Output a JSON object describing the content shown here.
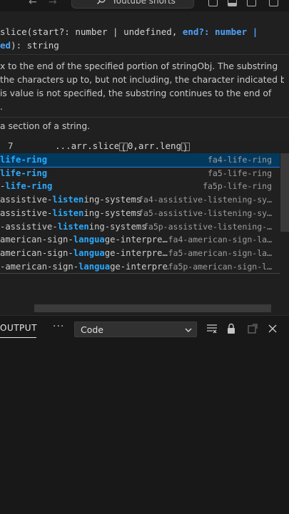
{
  "titlebar": {
    "search_text": "Youtube shorts",
    "back_arrow": "←",
    "forward_arrow": "→"
  },
  "hover_doc": {
    "signature_line1_prefix": "slice(start?: number | undefined, ",
    "signature_line1_param": "end?: number |",
    "signature_line2_param_tail": "ed",
    "signature_line2_rest": "): string",
    "description_lines": [
      "x to the end of the specified portion of stringObj. The substring",
      " the characters up to, but not including, the character indicated by",
      " is value is not specified, the substring continues to the end of",
      "."
    ],
    "summary": "a section of a string."
  },
  "editor": {
    "line_number": "7",
    "code_prefix": "...arr.slice",
    "code_bracket_open": "(",
    "code_middle": "0,arr.leng",
    "code_bracket_close": ")"
  },
  "suggestions": [
    {
      "label_pre": "",
      "label_hl": "life-ring",
      "label_post": "",
      "detail": "fa4-life-ring",
      "selected": true
    },
    {
      "label_pre": "",
      "label_hl": "life-ring",
      "label_post": "",
      "detail": "fa5-life-ring",
      "selected": false
    },
    {
      "label_pre": "-",
      "label_hl": "life-ring",
      "label_post": "",
      "detail": "fa5p-life-ring",
      "selected": false
    },
    {
      "label_pre": "assistive-",
      "label_hl": "listen",
      "label_post": "ing-systems",
      "detail": "fa4-assistive-listening-sy…",
      "selected": false
    },
    {
      "label_pre": "assistive-",
      "label_hl": "listen",
      "label_post": "ing-systems",
      "detail": "fa5-assistive-listening-sy…",
      "selected": false
    },
    {
      "label_pre": "-assistive-",
      "label_hl": "listen",
      "label_post": "ing-systems",
      "detail": "fa5p-assistive-listening-…",
      "selected": false
    },
    {
      "label_pre": "american-sign-",
      "label_hl": "langua",
      "label_post": "ge-interpre…",
      "detail": "fa4-american-sign-la…",
      "selected": false
    },
    {
      "label_pre": "american-sign-",
      "label_hl": "langua",
      "label_post": "ge-interpre…",
      "detail": "fa5-american-sign-la…",
      "selected": false
    },
    {
      "label_pre": "-american-sign-",
      "label_hl": "langua",
      "label_post": "ge-interpre…",
      "detail": "fa5p-american-sign-l…",
      "selected": false
    }
  ],
  "panel": {
    "tab_label": "OUTPUT",
    "more_label": "···",
    "channel_selected": "Code"
  },
  "icons": {
    "search": "search-icon",
    "layout": "layout-icon",
    "chevron": "chevron-down-icon",
    "filter": "filter-list-icon",
    "lock": "lock-icon",
    "popout": "open-in-editor-icon",
    "close": "close-icon"
  },
  "colors": {
    "accent": "#2aaaff",
    "selection": "#04395e",
    "keyword": "#4fa3f7"
  }
}
